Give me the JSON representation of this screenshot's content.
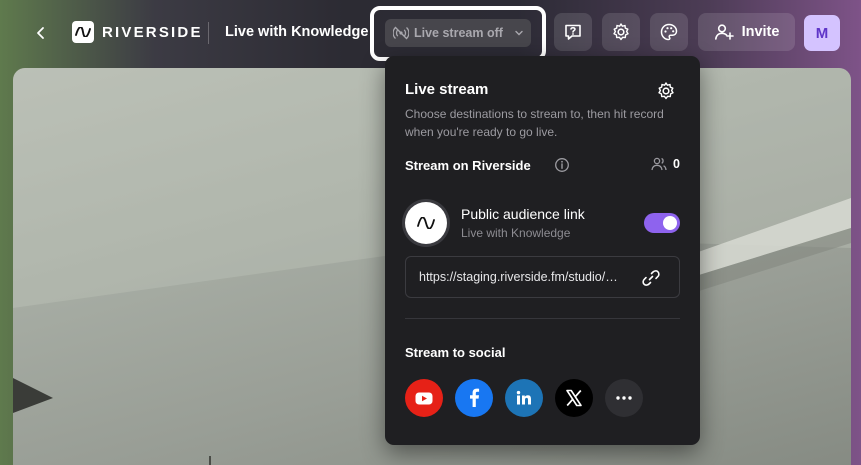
{
  "header": {
    "brand": "RIVERSIDE",
    "session_title": "Live with Knowledge",
    "live_stream_button": "Live stream off",
    "invite_label": "Invite",
    "avatar_initial": "M",
    "icons": {
      "back": "chevron-left-icon",
      "live": "broadcast-off-icon",
      "dropdown": "chevron-down-icon",
      "help": "help-chat-icon",
      "settings": "gear-icon",
      "theme": "palette-icon",
      "invite": "add-user-icon"
    }
  },
  "popover": {
    "title": "Live stream",
    "description": "Choose destinations to stream to, then hit record when you're ready to go live.",
    "stream_on_label": "Stream on Riverside",
    "viewers_count": "0",
    "audience_link": {
      "title": "Public audience link",
      "subtitle": "Live with Knowledge",
      "enabled": true,
      "url": "https://staging.riverside.fm/studio/live-with-knowledge"
    },
    "social_label": "Stream to social",
    "social": [
      {
        "name": "YouTube",
        "icon": "youtube-icon",
        "color": "#e62117"
      },
      {
        "name": "Facebook",
        "icon": "facebook-icon",
        "color": "#1877f2"
      },
      {
        "name": "LinkedIn",
        "icon": "linkedin-icon",
        "color": "#1d74b6"
      },
      {
        "name": "X",
        "icon": "x-icon",
        "color": "#000000"
      },
      {
        "name": "More",
        "icon": "more-icon",
        "color": "#2f2f33"
      }
    ]
  },
  "colors": {
    "accent_toggle": "#8e63ee",
    "avatar_bg": "#d4c3ff",
    "popover_bg": "#1f1f22"
  }
}
